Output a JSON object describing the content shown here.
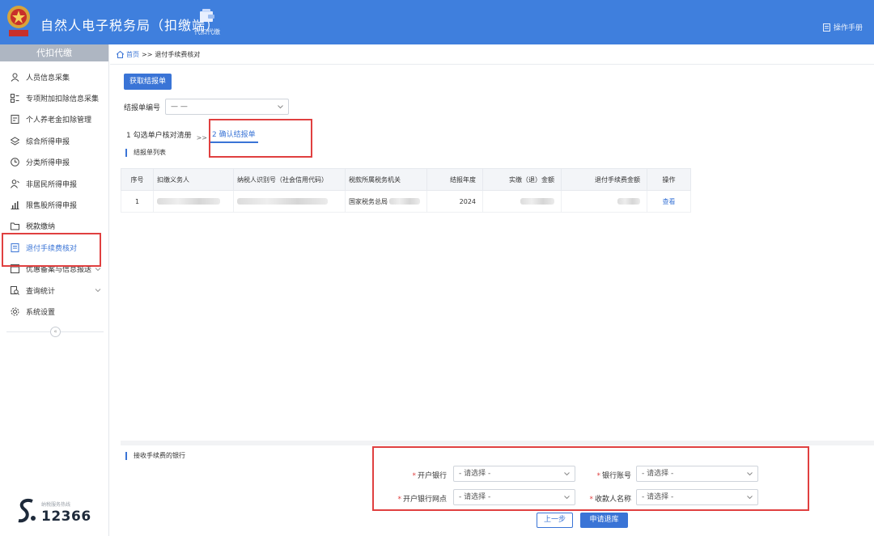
{
  "header": {
    "title": "自然人电子税务局（扣缴端）",
    "module_tab": "代扣代缴",
    "manual_link": "操作手册",
    "colors": {
      "header_bg": "#3f7fdd",
      "accent": "#3a74d6",
      "highlight_red": "#e04040"
    }
  },
  "sidebar": {
    "heading": "代扣代缴",
    "items": [
      {
        "label": "人员信息采集",
        "icon": "person-icon"
      },
      {
        "label": "专项附加扣除信息采集",
        "icon": "grid-icon"
      },
      {
        "label": "个人养老金扣除管理",
        "icon": "document-icon"
      },
      {
        "label": "综合所得申报",
        "icon": "layers-icon"
      },
      {
        "label": "分类所得申报",
        "icon": "clock-icon"
      },
      {
        "label": "非居民所得申报",
        "icon": "person-outline-icon"
      },
      {
        "label": "限售股所得申报",
        "icon": "bar-chart-icon"
      },
      {
        "label": "税款缴纳",
        "icon": "folder-icon"
      },
      {
        "label": "退付手续费核对",
        "icon": "receipt-icon",
        "active": true
      },
      {
        "label": "优惠备案与信息报送",
        "icon": "file-icon",
        "expandable": true
      },
      {
        "label": "查询统计",
        "icon": "search-list-icon",
        "expandable": true
      },
      {
        "label": "系统设置",
        "icon": "gear-icon"
      }
    ],
    "hotline_label": "纳税服务热线",
    "hotline_number": "12366"
  },
  "breadcrumb": {
    "home": "首页",
    "separator": ">>",
    "current": "退付手续费核对"
  },
  "main": {
    "get_button": "获取结报单",
    "report_no_label": "结报单编号",
    "report_no_value": "— —",
    "steps": [
      {
        "label": "1 勾选单户核对清册",
        "current": false
      },
      {
        "label": "2 确认结报单",
        "current": true
      }
    ],
    "step_separator": ">>",
    "list_title": "结报单列表",
    "table": {
      "columns": [
        "序号",
        "扣缴义务人",
        "纳税人识别号（社会信用代码）",
        "税款所属税务机关",
        "结报年度",
        "实缴（退）金额",
        "退付手续费金额",
        "操作"
      ],
      "rows": [
        {
          "index": "1",
          "tax_office": "国家税务总局",
          "year": "2024",
          "action": "查看"
        }
      ]
    },
    "bank_section_title": "接收手续费的银行",
    "bank_fields": [
      {
        "label": "开户银行",
        "value": "- 请选择 -",
        "required": true
      },
      {
        "label": "银行账号",
        "value": "- 请选择 -",
        "required": true
      },
      {
        "label": "开户银行网点",
        "value": "- 请选择 -",
        "required": true
      },
      {
        "label": "收款人名称",
        "value": "- 请选择 -",
        "required": true
      }
    ],
    "prev_button": "上一步",
    "apply_button": "申请退库"
  }
}
